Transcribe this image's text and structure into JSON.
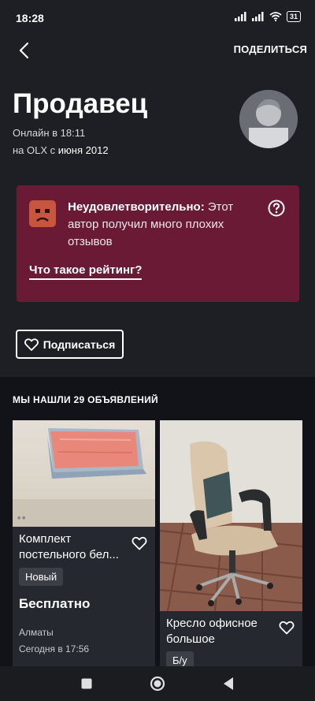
{
  "status": {
    "time": "18:28",
    "battery": "31"
  },
  "topbar": {
    "share_label": "ПОДЕЛИТЬСЯ"
  },
  "seller": {
    "title": "Продавец",
    "online": "Онлайн в 18:11",
    "since_prefix": "на OLX с",
    "since_date": "июня 2012"
  },
  "rating": {
    "label": "Неудовлетворительно:",
    "line1": " Этот",
    "line2": "автор получил много плохих",
    "line3": "отзывов",
    "link": "Что такое рейтинг?"
  },
  "follow": {
    "label": "Подписаться"
  },
  "listings": {
    "found_text": "МЫ НАШЛИ 29 ОБЪЯВЛЕНИЙ",
    "items": [
      {
        "title_line1": "Комплект",
        "title_line2": "постельного бел...",
        "condition": "Новый",
        "price": "Бесплатно",
        "city": "Алматы",
        "date": "Сегодня в 17:56"
      },
      {
        "title_line1": "Кресло офисное",
        "title_line2": "большое",
        "condition": "Б/у"
      }
    ]
  },
  "colors": {
    "background": "#1d1f24",
    "rating_card": "#6a1a35",
    "listings_bg": "#111318",
    "card_bg": "#25282e"
  }
}
